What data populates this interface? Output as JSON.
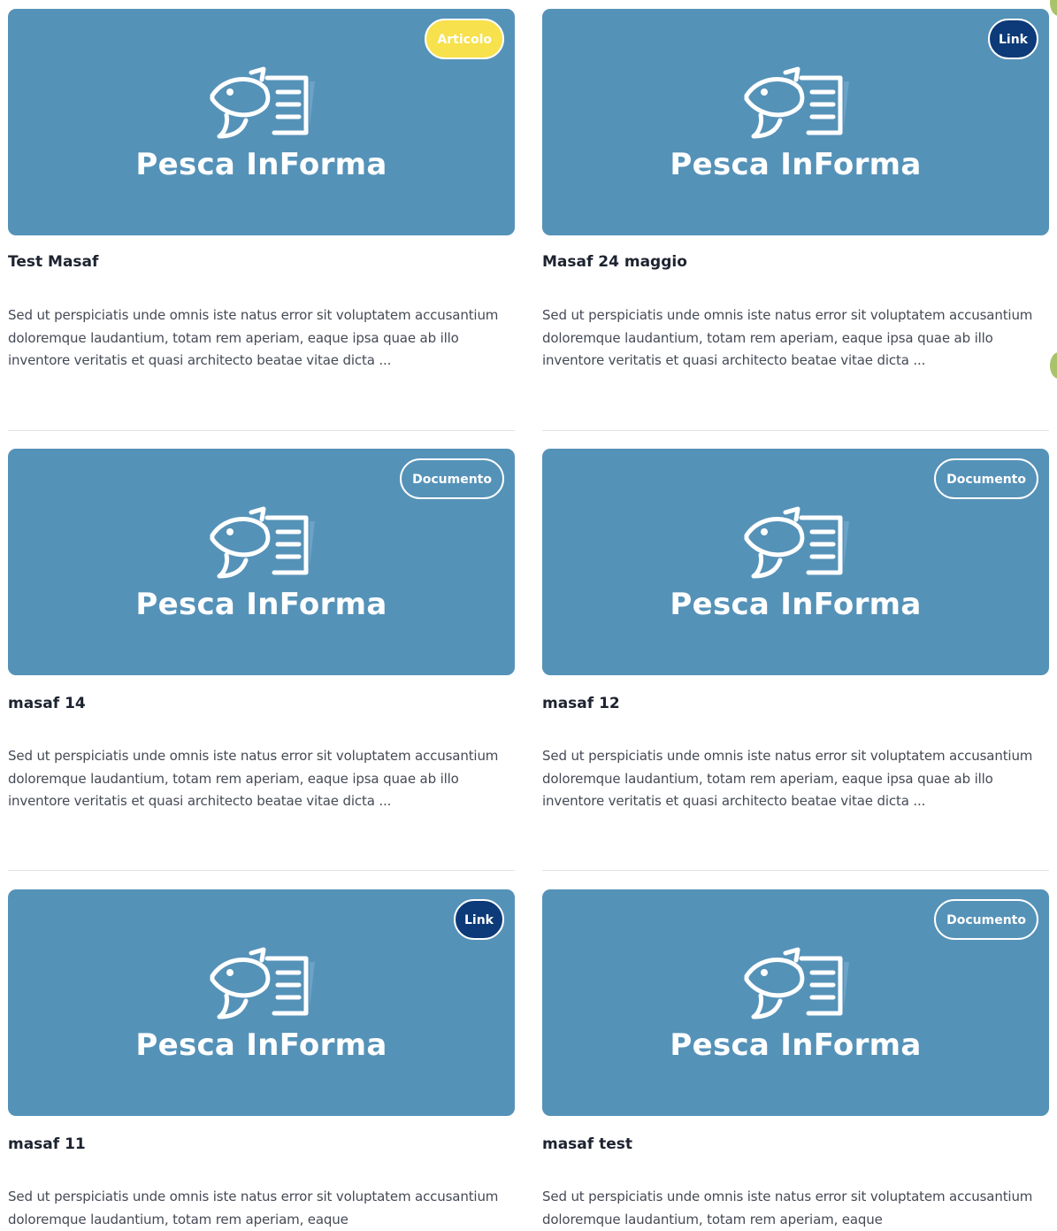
{
  "cards": [
    {
      "badge": "Articolo",
      "badge_type": "articolo",
      "brand": "Pesca InForma",
      "title": "Test Masaf",
      "excerpt": "Sed ut perspiciatis unde omnis iste natus error sit voluptatem accusantium doloremque laudantium, totam rem aperiam, eaque ipsa quae ab illo inventore veritatis et quasi architecto beatae vitae dicta ..."
    },
    {
      "badge": "Link",
      "badge_type": "link",
      "brand": "Pesca InForma",
      "title": "Masaf 24 maggio",
      "excerpt": "Sed ut perspiciatis unde omnis iste natus error sit voluptatem accusantium doloremque laudantium, totam rem aperiam, eaque ipsa quae ab illo inventore veritatis et quasi architecto beatae vitae dicta ..."
    },
    {
      "badge": "Documento",
      "badge_type": "documento",
      "brand": "Pesca InForma",
      "title": "masaf 14",
      "excerpt": "Sed ut perspiciatis unde omnis iste natus error sit voluptatem accusantium doloremque laudantium, totam rem aperiam, eaque ipsa quae ab illo inventore veritatis et quasi architecto beatae vitae dicta ..."
    },
    {
      "badge": "Documento",
      "badge_type": "documento",
      "brand": "Pesca InForma",
      "title": "masaf 12",
      "excerpt": "Sed ut perspiciatis unde omnis iste natus error sit voluptatem accusantium doloremque laudantium, totam rem aperiam, eaque ipsa quae ab illo inventore veritatis et quasi architecto beatae vitae dicta ..."
    },
    {
      "badge": "Link",
      "badge_type": "link",
      "brand": "Pesca InForma",
      "title": "masaf 11",
      "excerpt": "Sed ut perspiciatis unde omnis iste natus error sit voluptatem accusantium doloremque laudantium, totam rem aperiam, eaque"
    },
    {
      "badge": "Documento",
      "badge_type": "documento",
      "brand": "Pesca InForma",
      "title": "masaf test",
      "excerpt": "Sed ut perspiciatis unde omnis iste natus error sit voluptatem accusantium doloremque laudantium, totam rem aperiam, eaque"
    }
  ],
  "colors": {
    "thumb_bg": "#5592b8",
    "badge_articolo": "#f7e14c",
    "badge_link": "#0d3a78",
    "title_text": "#1d2330",
    "body_text": "#444a55"
  },
  "icons": {
    "brand_logo": "fish-document-icon"
  }
}
